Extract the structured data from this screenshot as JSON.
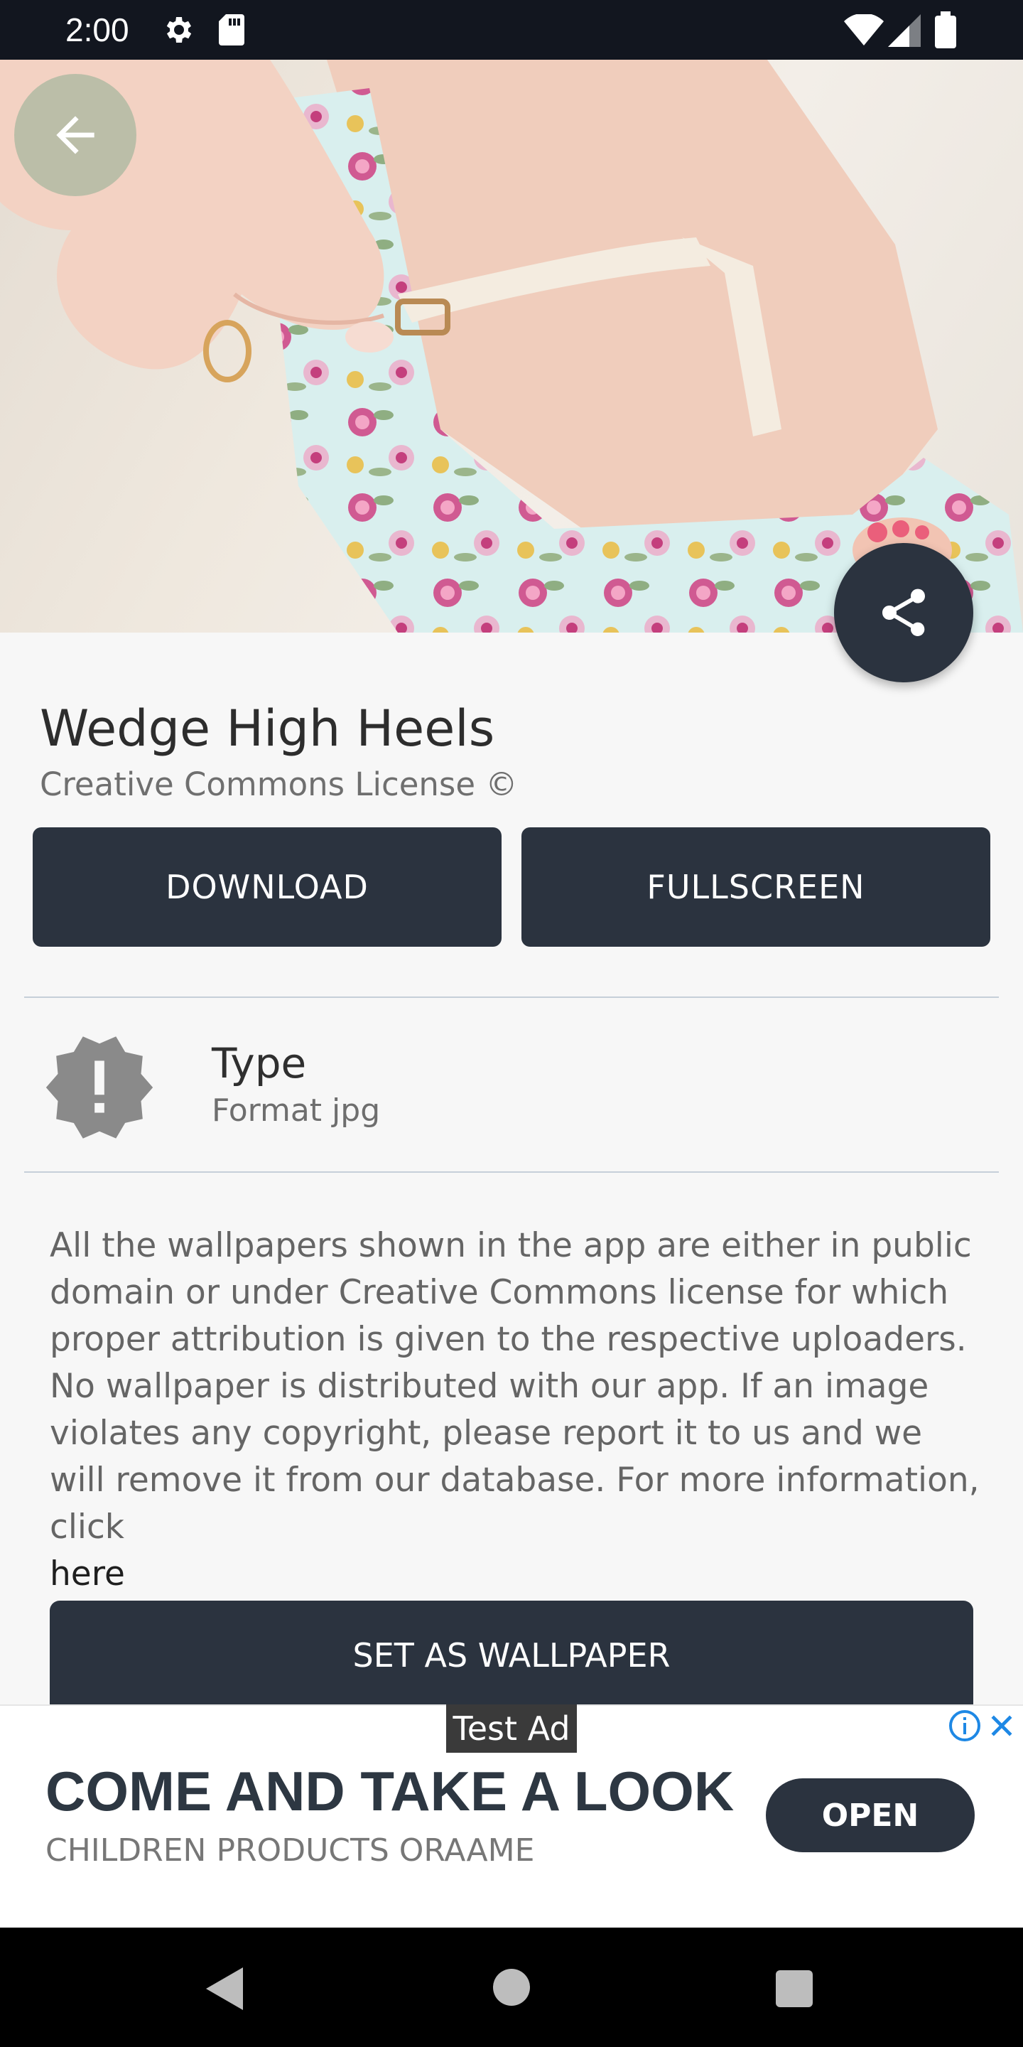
{
  "status_bar": {
    "time": "2:00",
    "icons": [
      "settings-icon",
      "sd-card-icon",
      "wifi-icon",
      "signal-icon",
      "battery-icon"
    ]
  },
  "hero": {
    "image_subject": "floral-wedge-heel-photo"
  },
  "wallpaper": {
    "title": "Wedge High Heels",
    "license": "Creative Commons License ©"
  },
  "actions": {
    "download_label": "DOWNLOAD",
    "fullscreen_label": "FULLSCREEN",
    "set_wallpaper_label": "SET AS WALLPAPER"
  },
  "info": {
    "type_label": "Type",
    "type_value": "Format jpg"
  },
  "disclaimer": {
    "text": "All the wallpapers shown in the app are either in public domain or under Creative Commons license for which proper attribution is given to the respective uploaders. No wallpaper is distributed with our app. If an image violates any copyright, please report it to us and we will remove it from our database. For more information, click",
    "link_text": "here"
  },
  "ad": {
    "tag": "Test Ad",
    "headline": "COME AND TAKE A LOOK",
    "subline": "CHILDREN PRODUCTS ORAAME",
    "cta": "OPEN"
  },
  "colors": {
    "dark_button": "#2b333f",
    "background": "#f7f7f7",
    "status_bar": "#12161f",
    "ad_info_blue": "#1e88e5"
  }
}
